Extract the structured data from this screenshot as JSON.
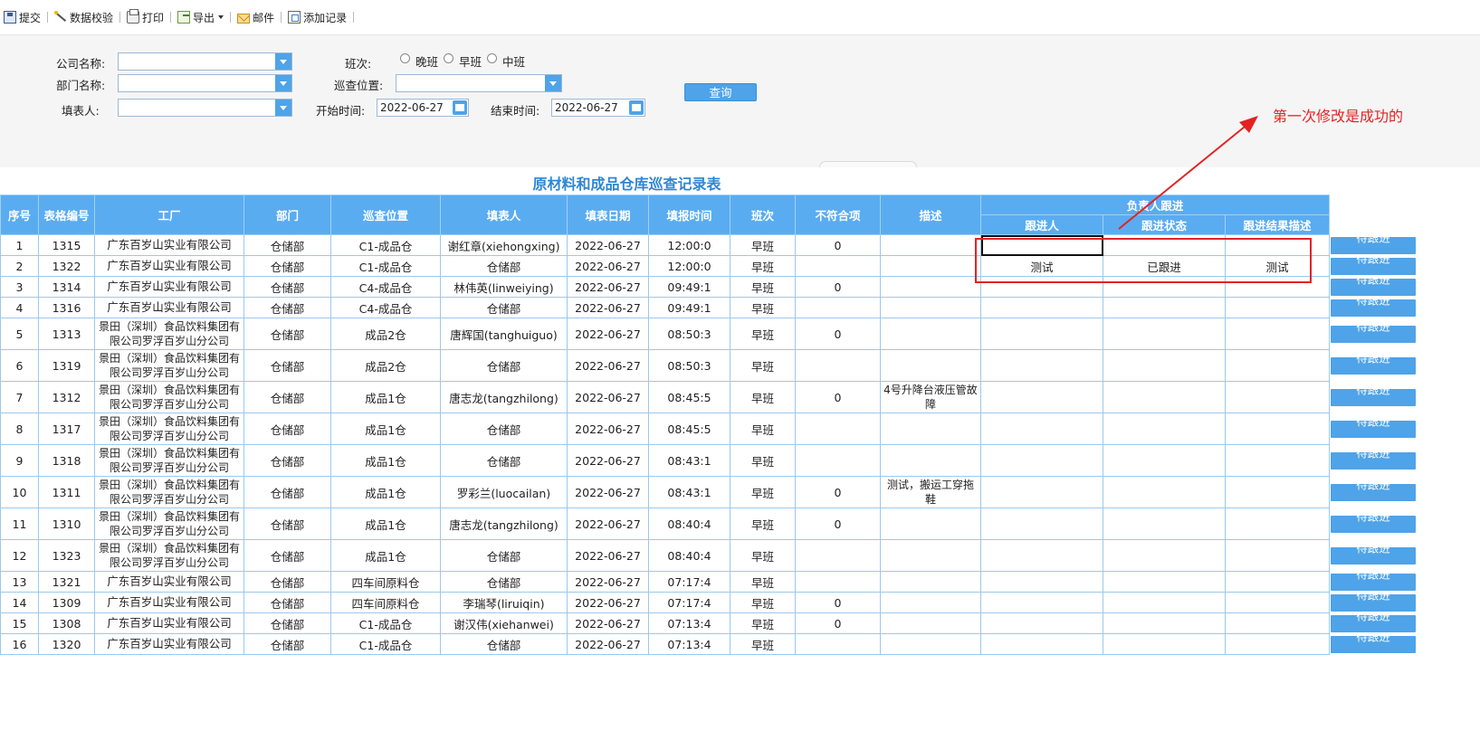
{
  "toolbar": {
    "items": [
      {
        "label": "提交",
        "icon": "save-icon"
      },
      {
        "label": "数据校验",
        "icon": "wand-icon"
      },
      {
        "label": "打印",
        "icon": "print-icon"
      },
      {
        "label": "导出",
        "icon": "export-icon"
      },
      {
        "label": "邮件",
        "icon": "mail-icon"
      },
      {
        "label": "添加记录",
        "icon": "add-record-icon"
      }
    ]
  },
  "query": {
    "company_label": "公司名称:",
    "dept_label": "部门名称:",
    "filler_label": "填表人:",
    "shift_label": "班次:",
    "shift_options": [
      "晚班",
      "早班",
      "中班"
    ],
    "location_label": "巡查位置:",
    "start_label": "开始时间:",
    "start_value": "2022-06-27",
    "end_label": "结束时间:",
    "end_value": "2022-06-27",
    "search_button": "查询"
  },
  "report": {
    "title": "原材料和成品仓库巡查记录表",
    "headers": [
      "序号",
      "表格编号",
      "工厂",
      "部门",
      "巡查位置",
      "填表人",
      "填表日期",
      "填报时间",
      "班次",
      "不符合项",
      "描述"
    ],
    "group_header": "负责人跟进",
    "sub_headers": [
      "跟进人",
      "跟进状态",
      "跟进结果描述"
    ],
    "action_label": "待跟进",
    "rows": [
      {
        "no": "1",
        "code": "1315",
        "factory": "广东百岁山实业有限公司",
        "dept": "仓储部",
        "location": "C1-成品仓",
        "filler": "谢红章(xiehongxing)",
        "date": "2022-06-27",
        "time": "12:00:0",
        "shift": "早班",
        "nc": "0",
        "desc": "",
        "follower": "",
        "status": "",
        "result": ""
      },
      {
        "no": "2",
        "code": "1322",
        "factory": "广东百岁山实业有限公司",
        "dept": "仓储部",
        "location": "C1-成品仓",
        "filler": "仓储部",
        "date": "2022-06-27",
        "time": "12:00:0",
        "shift": "早班",
        "nc": "",
        "desc": "",
        "follower": "测试",
        "status": "已跟进",
        "result": "测试"
      },
      {
        "no": "3",
        "code": "1314",
        "factory": "广东百岁山实业有限公司",
        "dept": "仓储部",
        "location": "C4-成品仓",
        "filler": "林伟英(linweiying)",
        "date": "2022-06-27",
        "time": "09:49:1",
        "shift": "早班",
        "nc": "0",
        "desc": "",
        "follower": "",
        "status": "",
        "result": ""
      },
      {
        "no": "4",
        "code": "1316",
        "factory": "广东百岁山实业有限公司",
        "dept": "仓储部",
        "location": "C4-成品仓",
        "filler": "仓储部",
        "date": "2022-06-27",
        "time": "09:49:1",
        "shift": "早班",
        "nc": "",
        "desc": "",
        "follower": "",
        "status": "",
        "result": ""
      },
      {
        "no": "5",
        "code": "1313",
        "factory": "景田（深圳）食品饮料集团有限公司罗浮百岁山分公司",
        "dept": "仓储部",
        "location": "成品2仓",
        "filler": "唐辉国(tanghuiguo)",
        "date": "2022-06-27",
        "time": "08:50:3",
        "shift": "早班",
        "nc": "0",
        "desc": "",
        "follower": "",
        "status": "",
        "result": ""
      },
      {
        "no": "6",
        "code": "1319",
        "factory": "景田（深圳）食品饮料集团有限公司罗浮百岁山分公司",
        "dept": "仓储部",
        "location": "成品2仓",
        "filler": "仓储部",
        "date": "2022-06-27",
        "time": "08:50:3",
        "shift": "早班",
        "nc": "",
        "desc": "",
        "follower": "",
        "status": "",
        "result": ""
      },
      {
        "no": "7",
        "code": "1312",
        "factory": "景田（深圳）食品饮料集团有限公司罗浮百岁山分公司",
        "dept": "仓储部",
        "location": "成品1仓",
        "filler": "唐志龙(tangzhilong)",
        "date": "2022-06-27",
        "time": "08:45:5",
        "shift": "早班",
        "nc": "0",
        "desc": "4号升降台液压管故障",
        "follower": "",
        "status": "",
        "result": ""
      },
      {
        "no": "8",
        "code": "1317",
        "factory": "景田（深圳）食品饮料集团有限公司罗浮百岁山分公司",
        "dept": "仓储部",
        "location": "成品1仓",
        "filler": "仓储部",
        "date": "2022-06-27",
        "time": "08:45:5",
        "shift": "早班",
        "nc": "",
        "desc": "",
        "follower": "",
        "status": "",
        "result": ""
      },
      {
        "no": "9",
        "code": "1318",
        "factory": "景田（深圳）食品饮料集团有限公司罗浮百岁山分公司",
        "dept": "仓储部",
        "location": "成品1仓",
        "filler": "仓储部",
        "date": "2022-06-27",
        "time": "08:43:1",
        "shift": "早班",
        "nc": "",
        "desc": "",
        "follower": "",
        "status": "",
        "result": ""
      },
      {
        "no": "10",
        "code": "1311",
        "factory": "景田（深圳）食品饮料集团有限公司罗浮百岁山分公司",
        "dept": "仓储部",
        "location": "成品1仓",
        "filler": "罗彩兰(luocailan)",
        "date": "2022-06-27",
        "time": "08:43:1",
        "shift": "早班",
        "nc": "0",
        "desc": "测试，搬运工穿拖鞋",
        "follower": "",
        "status": "",
        "result": ""
      },
      {
        "no": "11",
        "code": "1310",
        "factory": "景田（深圳）食品饮料集团有限公司罗浮百岁山分公司",
        "dept": "仓储部",
        "location": "成品1仓",
        "filler": "唐志龙(tangzhilong)",
        "date": "2022-06-27",
        "time": "08:40:4",
        "shift": "早班",
        "nc": "0",
        "desc": "",
        "follower": "",
        "status": "",
        "result": ""
      },
      {
        "no": "12",
        "code": "1323",
        "factory": "景田（深圳）食品饮料集团有限公司罗浮百岁山分公司",
        "dept": "仓储部",
        "location": "成品1仓",
        "filler": "仓储部",
        "date": "2022-06-27",
        "time": "08:40:4",
        "shift": "早班",
        "nc": "",
        "desc": "",
        "follower": "",
        "status": "",
        "result": ""
      },
      {
        "no": "13",
        "code": "1321",
        "factory": "广东百岁山实业有限公司",
        "dept": "仓储部",
        "location": "四车间原料仓",
        "filler": "仓储部",
        "date": "2022-06-27",
        "time": "07:17:4",
        "shift": "早班",
        "nc": "",
        "desc": "",
        "follower": "",
        "status": "",
        "result": ""
      },
      {
        "no": "14",
        "code": "1309",
        "factory": "广东百岁山实业有限公司",
        "dept": "仓储部",
        "location": "四车间原料仓",
        "filler": "李瑞琴(liruiqin)",
        "date": "2022-06-27",
        "time": "07:17:4",
        "shift": "早班",
        "nc": "0",
        "desc": "",
        "follower": "",
        "status": "",
        "result": ""
      },
      {
        "no": "15",
        "code": "1308",
        "factory": "广东百岁山实业有限公司",
        "dept": "仓储部",
        "location": "C1-成品仓",
        "filler": "谢汉伟(xiehanwei)",
        "date": "2022-06-27",
        "time": "07:13:4",
        "shift": "早班",
        "nc": "0",
        "desc": "",
        "follower": "",
        "status": "",
        "result": ""
      },
      {
        "no": "16",
        "code": "1320",
        "factory": "广东百岁山实业有限公司",
        "dept": "仓储部",
        "location": "C1-成品仓",
        "filler": "仓储部",
        "date": "2022-06-27",
        "time": "07:13:4",
        "shift": "早班",
        "nc": "",
        "desc": "",
        "follower": "",
        "status": "",
        "result": ""
      }
    ]
  },
  "annotation": {
    "text": "第一次修改是成功的",
    "color": "#e32323"
  }
}
